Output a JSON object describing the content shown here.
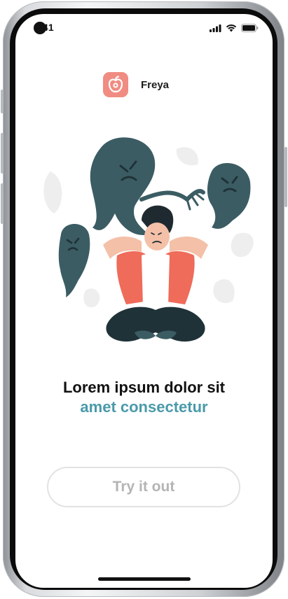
{
  "status_bar": {
    "time": "9:41",
    "icons": [
      "signal-icon",
      "wifi-icon",
      "battery-icon"
    ]
  },
  "brand": {
    "name": "Freya",
    "logo_icon": "apple-logo-icon",
    "logo_color": "#f08c82"
  },
  "illustration": {
    "subject": "anxious-woman-with-ghosts",
    "colors": {
      "ghost": "#3b5c63",
      "shirt": "#ef6b5a",
      "pants": "#1f3238",
      "blob": "#eeeeee"
    }
  },
  "headline": {
    "line1": "Lorem ipsum dolor sit",
    "line2": "amet consectetur",
    "accent_color": "#4a9aaa"
  },
  "cta": {
    "label": "Try it out"
  }
}
